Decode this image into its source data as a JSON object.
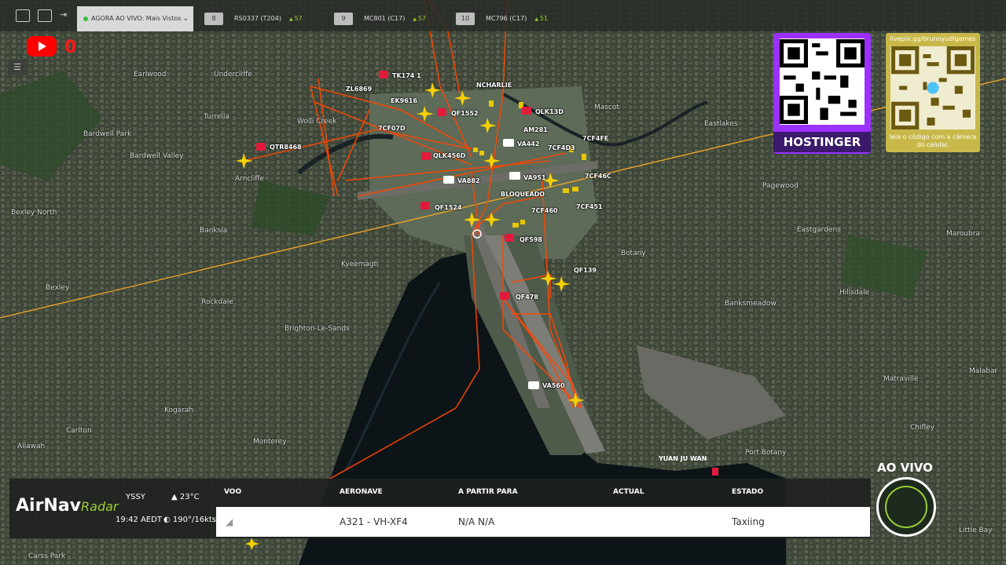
{
  "topbar": {
    "live_label": "AGORA AO VIVO: Mais Vistos",
    "slots": [
      {
        "num": "8",
        "flight": "RS0337 (T204)",
        "count": "57"
      },
      {
        "num": "9",
        "flight": "MC801 (C17)",
        "count": "57"
      },
      {
        "num": "10",
        "flight": "MC796 (C17)",
        "count": "51"
      }
    ]
  },
  "youtube": {
    "count": "0"
  },
  "sponsor": {
    "name": "HOSTINGER"
  },
  "qr2": {
    "url": "liveplx.gg/brunoyudigames",
    "caption": "leia o código com a câmera do celular."
  },
  "flights": [
    {
      "label": "TK174 1"
    },
    {
      "label": "ZL6869"
    },
    {
      "label": "EK9616"
    },
    {
      "label": "NCHARLIE"
    },
    {
      "label": "QF1552"
    },
    {
      "label": "QLK13D"
    },
    {
      "label": "7CF07D"
    },
    {
      "label": "AM281"
    },
    {
      "label": "QTR8468"
    },
    {
      "label": "VA442"
    },
    {
      "label": "7CF4D3"
    },
    {
      "label": "7CF4FE"
    },
    {
      "label": "QLK456D"
    },
    {
      "label": "VA882"
    },
    {
      "label": "VA951"
    },
    {
      "label": "7CF46C"
    },
    {
      "label": "BLOQUEADO"
    },
    {
      "label": "QF1524"
    },
    {
      "label": "7CF460"
    },
    {
      "label": "7CF451"
    },
    {
      "label": "QF598"
    },
    {
      "label": "QF139"
    },
    {
      "label": "QF478"
    },
    {
      "label": "VA560"
    },
    {
      "label": "YUAN JU WAN"
    }
  ],
  "places": [
    "Earlwood",
    "Undercliffe",
    "Turrella",
    "Wolli Creek",
    "Bardwell Park",
    "Bardwell Valley",
    "Arncliffe",
    "Bexley North",
    "Banksia",
    "Kyeemagh",
    "Bexley",
    "Rockdale",
    "Brighton-Le-Sands",
    "Kogarah",
    "Carlton",
    "Allawah",
    "Monterey",
    "Carss Park",
    "Mascot",
    "Eastlakes",
    "Pagewood",
    "Eastgardens",
    "Maroubra",
    "Hillsdale",
    "Banksmeadow",
    "Botany",
    "Matraville",
    "Malabar",
    "Port Botany",
    "Chifley",
    "Little Bay"
  ],
  "panel": {
    "brand_main": "AirNav",
    "brand_sub": "Radar",
    "airport": "YSSY",
    "time": "19:42 AEDT",
    "temp": "23°C",
    "wind": "190°/16kts",
    "headers": {
      "flight": "VOO",
      "aircraft": "AERONAVE",
      "from_to": "A PARTIR PARA",
      "actual": "ACTUAL",
      "status": "ESTADO"
    },
    "row": {
      "aircraft": "A321 - VH-XF4",
      "from_to": "N/A N/A",
      "status": "Taxiing"
    }
  },
  "live_badge": "AO VIVO",
  "colors": {
    "track": "#ff4500",
    "route": "#f5a623",
    "plane": "#f5d000",
    "accent": "#9acd32",
    "hostinger": "#9b30ff"
  }
}
